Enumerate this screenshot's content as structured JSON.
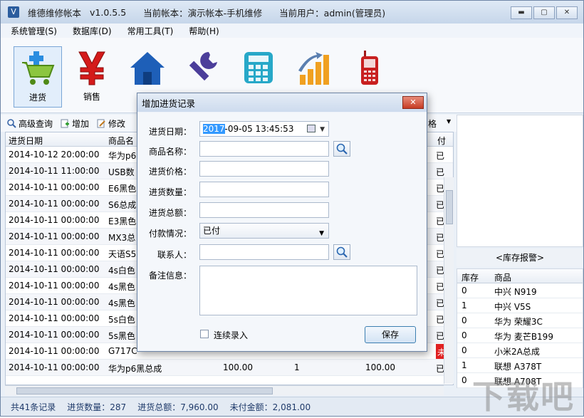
{
  "titlebar": {
    "app_name": "维德维修帐本",
    "version": "v1.0.5.5",
    "account": "当前帐本：演示帐本-手机维修",
    "user": "当前用户：admin(管理员)"
  },
  "menubar": [
    "系统管理(S)",
    "数据库(D)",
    "常用工具(T)",
    "帮助(H)"
  ],
  "toolbar": {
    "items": [
      {
        "label": "进货",
        "icon": "cart-icon"
      },
      {
        "label": "销售",
        "icon": "yen-icon"
      },
      {
        "label": "",
        "icon": "home-icon"
      },
      {
        "label": "",
        "icon": "wrench-icon"
      },
      {
        "label": "",
        "icon": "calculator-icon"
      },
      {
        "label": "",
        "icon": "growth-chart-icon"
      },
      {
        "label": "",
        "icon": "mobile-phone-icon"
      }
    ]
  },
  "gridbar": {
    "advanced_search": "高级查询",
    "add": "增加",
    "edit": "修改",
    "price_col_fragment": "格"
  },
  "grid": {
    "columns": [
      "进货日期",
      "商品名",
      "付"
    ],
    "rows": [
      {
        "date": "2014-10-12 20:00:00",
        "name": "华为p6",
        "price": "",
        "qty": "",
        "total": "",
        "status": "已"
      },
      {
        "date": "2014-10-11 11:00:00",
        "name": "USB数",
        "price": "",
        "qty": "",
        "total": "",
        "status": "已"
      },
      {
        "date": "2014-10-11 00:00:00",
        "name": "E6黑色",
        "price": "",
        "qty": "",
        "total": "",
        "status": "已"
      },
      {
        "date": "2014-10-11 00:00:00",
        "name": "S6总成",
        "price": "",
        "qty": "",
        "total": "",
        "status": "已"
      },
      {
        "date": "2014-10-11 00:00:00",
        "name": "E3黑色",
        "price": "",
        "qty": "",
        "total": "",
        "status": "已"
      },
      {
        "date": "2014-10-11 00:00:00",
        "name": "MX3总",
        "price": "",
        "qty": "",
        "total": "",
        "status": "已"
      },
      {
        "date": "2014-10-11 00:00:00",
        "name": "天语S5",
        "price": "",
        "qty": "",
        "total": "",
        "status": "已"
      },
      {
        "date": "2014-10-11 00:00:00",
        "name": "4s白色",
        "price": "",
        "qty": "",
        "total": "",
        "status": "已"
      },
      {
        "date": "2014-10-11 00:00:00",
        "name": "4s黑色",
        "price": "",
        "qty": "",
        "total": "",
        "status": "已"
      },
      {
        "date": "2014-10-11 00:00:00",
        "name": "4s黑色",
        "price": "",
        "qty": "",
        "total": "",
        "status": "已"
      },
      {
        "date": "2014-10-11 00:00:00",
        "name": "5s白色",
        "price": "",
        "qty": "",
        "total": "",
        "status": "已"
      },
      {
        "date": "2014-10-11 00:00:00",
        "name": "5s黑色",
        "price": "",
        "qty": "",
        "total": "",
        "status": "已"
      },
      {
        "date": "2014-10-11 00:00:00",
        "name": "G717C",
        "price": "",
        "qty": "",
        "total": "",
        "status": "未"
      },
      {
        "date": "2014-10-11 00:00:00",
        "name": "华为p6黑总成",
        "price": "100.00",
        "qty": "1",
        "total": "100.00",
        "status": "已"
      }
    ]
  },
  "right_panel": {
    "header": "<库存报警>",
    "columns": [
      "库存",
      "商品"
    ],
    "rows": [
      {
        "stock": "0",
        "product": "中兴 N919"
      },
      {
        "stock": "1",
        "product": "中兴 V5S"
      },
      {
        "stock": "0",
        "product": "华为 荣耀3C"
      },
      {
        "stock": "0",
        "product": "华为 麦芒B199"
      },
      {
        "stock": "0",
        "product": "小米2A总成"
      },
      {
        "stock": "1",
        "product": "联想 A378T"
      },
      {
        "stock": "0",
        "product": "联想 A708T"
      }
    ]
  },
  "statusbar": {
    "records": "共41条记录",
    "qty": "进货数量：287",
    "total": "进货总额：7,960.00",
    "unpaid": "未付金额：2,081.00"
  },
  "dialog": {
    "title": "增加进货记录",
    "date_label": "进货日期：",
    "date_year": "2017",
    "date_rest": "-09-05 13:45:53",
    "name_label": "商品名称：",
    "price_label": "进货价格：",
    "qty_label": "进货数量：",
    "total_label": "进货总额：",
    "payment_label": "付款情况：",
    "payment_value": "已付",
    "contact_label": "联系人：",
    "note_label": "备注信息：",
    "continuous_label": "连续录入",
    "save_label": "保存"
  },
  "watermark": "下载吧",
  "colors": {
    "unpaid": "#e02020",
    "selection": "#3399ff"
  }
}
